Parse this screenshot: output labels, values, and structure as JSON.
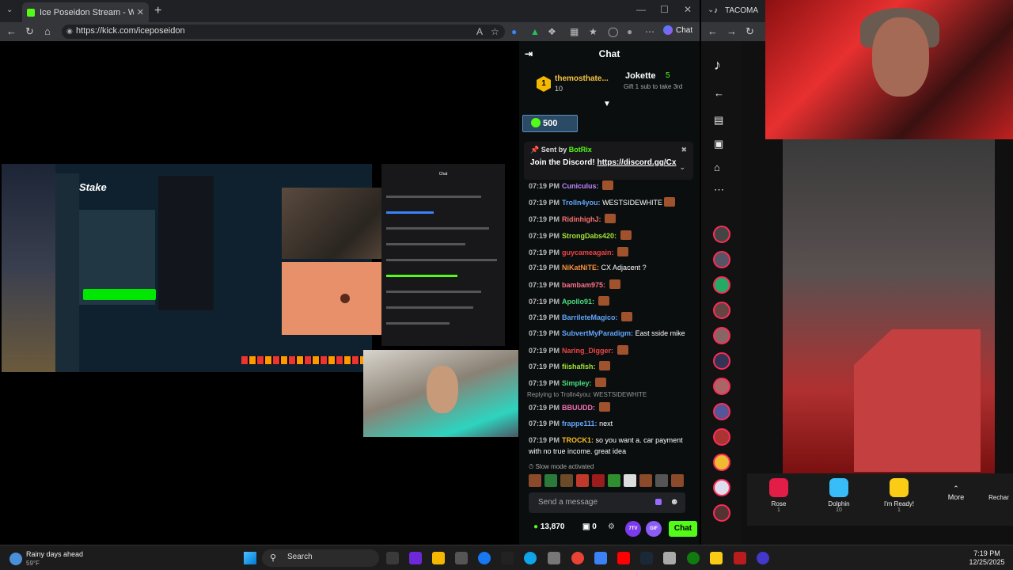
{
  "browser1": {
    "tab_title": "Ice Poseidon Stream - Watch",
    "url": "https://kick.com/iceposeidon",
    "chat_button": "Chat"
  },
  "embedded": {
    "stake_logo": "Stake",
    "mini_chat_header": "Chat"
  },
  "chat": {
    "header": "Chat",
    "leaders": [
      {
        "rank": "1",
        "name": "themosthate...",
        "count": "10"
      },
      {
        "name": "Jokette",
        "count": "5",
        "sub": "Gift 1 sub to take 3rd"
      }
    ],
    "points": "500",
    "pinned": {
      "sent_by_label": "Sent by",
      "bot": "BotRix",
      "message": "Join the Discord!",
      "link": "https://discord.gg/Cx"
    },
    "messages": [
      {
        "time": "07:19 PM",
        "user": "Cuniculus:",
        "color": "#c084fc",
        "text": "",
        "emote": true
      },
      {
        "time": "07:19 PM",
        "user": "Trolln4you:",
        "color": "#60a5fa",
        "text": "WESTSIDEWHITE",
        "emote": true
      },
      {
        "time": "07:19 PM",
        "user": "RidinhighJ:",
        "color": "#f87171",
        "text": "",
        "emote": true
      },
      {
        "time": "07:19 PM",
        "user": "StrongDabs420:",
        "color": "#a3e635",
        "text": "",
        "emote": true
      },
      {
        "time": "07:19 PM",
        "user": "guycameagain:",
        "color": "#ef4444",
        "text": "",
        "emote": true
      },
      {
        "time": "07:19 PM",
        "user": "NiKatNiTE:",
        "color": "#fb923c",
        "text": "CX Adjacent ?",
        "emote": false
      },
      {
        "time": "07:19 PM",
        "user": "bambam975:",
        "color": "#fb7185",
        "text": "",
        "emote": true
      },
      {
        "time": "07:19 PM",
        "user": "Apollo91:",
        "color": "#4ade80",
        "text": "",
        "emote": true
      },
      {
        "time": "07:19 PM",
        "user": "BarrileteMagico:",
        "color": "#60a5fa",
        "text": "",
        "emote": true
      },
      {
        "time": "07:19 PM",
        "user": "SubvertMyParadigm:",
        "color": "#60a5fa",
        "text": "East sside mike",
        "emote": false
      },
      {
        "time": "07:19 PM",
        "user": "Naring_Digger:",
        "color": "#ef4444",
        "text": "",
        "emote": true
      },
      {
        "time": "07:19 PM",
        "user": "fiishafish:",
        "color": "#a3e635",
        "text": "",
        "emote": true
      },
      {
        "time": "07:19 PM",
        "user": "Simpley:",
        "color": "#4ade80",
        "text": "",
        "emote": true
      },
      {
        "time": "07:19 PM",
        "user": "BBUUDD:",
        "color": "#f472b6",
        "text": "",
        "emote": true
      },
      {
        "time": "07:19 PM",
        "user": "frappe111:",
        "color": "#60a5fa",
        "text": "next",
        "emote": false
      },
      {
        "time": "07:19 PM",
        "user": "TROCK1:",
        "color": "#fbbf24",
        "text": "so you want a. car payment",
        "emote": false
      },
      {
        "time": "",
        "user": "",
        "color": "#ffffff",
        "text": "with no true income. great idea",
        "emote": false
      }
    ],
    "reply_text": "Replying to Trolln4you: WESTSIDEWHITE",
    "slow_mode": "Slow mode activated",
    "input_placeholder": "Send a message",
    "balance": "13,870",
    "gifts_count": "0",
    "badge_7tv": "7TV",
    "badge_gif": "GIF",
    "send_label": "Chat"
  },
  "browser2": {
    "tab_title": "TACOMA",
    "gifts": [
      {
        "name": "Rose",
        "price": "1",
        "color": "#e11d48"
      },
      {
        "name": "Dolphin",
        "price": "10",
        "color": "#38bdf8"
      },
      {
        "name": "I'm Ready!",
        "price": "1",
        "color": "#facc15"
      }
    ],
    "more_label": "More",
    "recharge_label": "Rechar"
  },
  "taskbar": {
    "weather_title": "Rainy days ahead",
    "weather_temp": "59°F",
    "search_label": "Search",
    "time": "7:19 PM",
    "date": "12/25/2025"
  }
}
